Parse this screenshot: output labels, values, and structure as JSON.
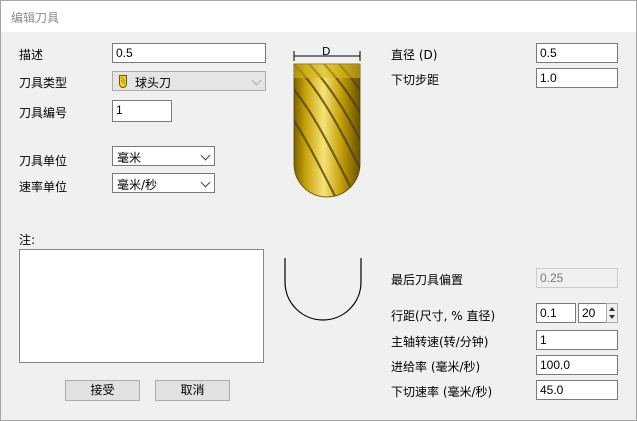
{
  "window": {
    "title": "编辑刀具"
  },
  "left": {
    "description_label": "描述",
    "description_value": "0.5",
    "tool_type_label": "刀具类型",
    "tool_type_value": "球头刀",
    "tool_number_label": "刀具编号",
    "tool_number_value": "1",
    "tool_units_label": "刀具单位",
    "tool_units_value": "毫米",
    "rate_units_label": "速率单位",
    "rate_units_value": "毫米/秒",
    "notes_label": "注:",
    "notes_value": ""
  },
  "diagram": {
    "dimension_label": "D"
  },
  "right": {
    "diameter_label": "直径 (D)",
    "diameter_value": "0.5",
    "stepdown_label": "下切步距",
    "stepdown_value": "1.0",
    "final_offset_label": "最后刀具偏置",
    "final_offset_value": "0.25",
    "stepover_label": "行距(尺寸, % 直径)",
    "stepover_value": "0.1",
    "stepover_percent": "20",
    "spindle_label": "主轴转速(转/分钟)",
    "spindle_value": "1",
    "feed_label": "进给率 (毫米/秒)",
    "feed_value": "100.0",
    "plunge_label": "下切速率 (毫米/秒)",
    "plunge_value": "45.0"
  },
  "buttons": {
    "accept": "接受",
    "cancel": "取消"
  }
}
